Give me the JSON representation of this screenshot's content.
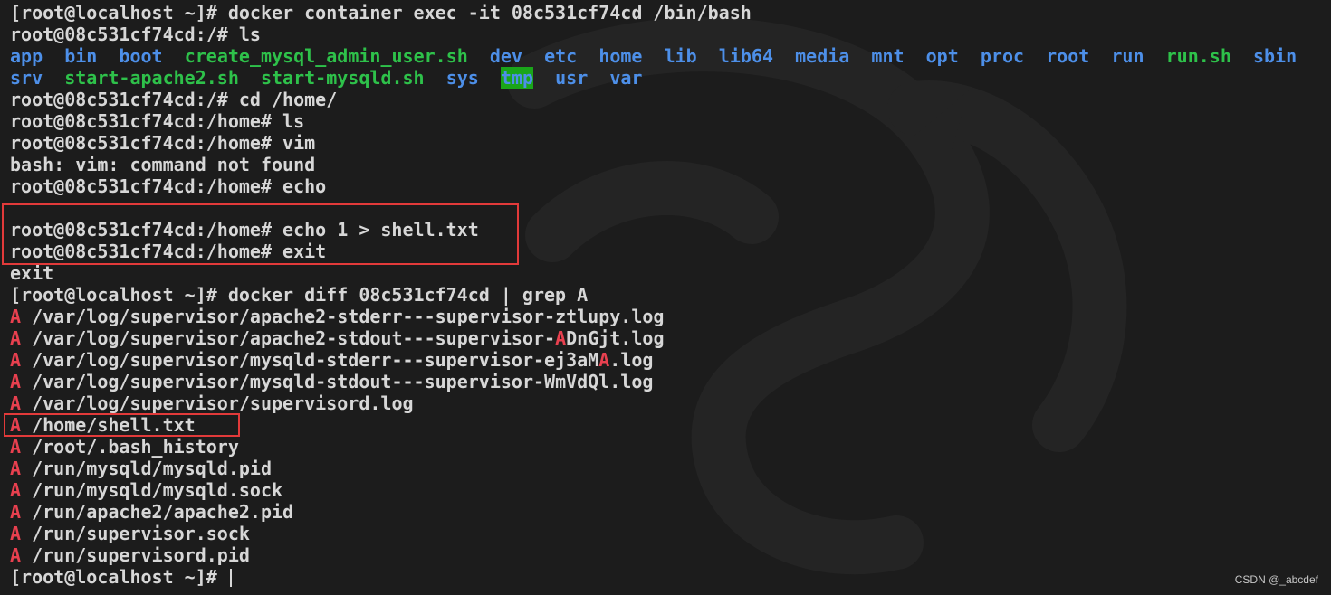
{
  "terminal": {
    "session": [
      {
        "prompt": "[root@localhost ~]# ",
        "command": "docker container exec -it 08c531cf74cd /bin/bash"
      },
      {
        "prompt": "root@08c531cf74cd:/# ",
        "command": "ls"
      }
    ],
    "ls_output": {
      "row1": [
        {
          "name": "app",
          "color": "blue"
        },
        {
          "name": "bin",
          "color": "blue"
        },
        {
          "name": "boot",
          "color": "blue"
        },
        {
          "name": "create_mysql_admin_user.sh",
          "color": "green"
        },
        {
          "name": "dev",
          "color": "blue"
        },
        {
          "name": "etc",
          "color": "blue"
        },
        {
          "name": "home",
          "color": "blue"
        },
        {
          "name": "lib",
          "color": "blue"
        },
        {
          "name": "lib64",
          "color": "blue"
        },
        {
          "name": "media",
          "color": "blue"
        },
        {
          "name": "mnt",
          "color": "blue"
        },
        {
          "name": "opt",
          "color": "blue"
        },
        {
          "name": "proc",
          "color": "blue"
        },
        {
          "name": "root",
          "color": "blue"
        },
        {
          "name": "run",
          "color": "blue"
        },
        {
          "name": "run.sh",
          "color": "green"
        },
        {
          "name": "sbin",
          "color": "blue"
        }
      ],
      "row2": [
        {
          "name": "srv",
          "color": "blue"
        },
        {
          "name": "start-apache2.sh",
          "color": "green"
        },
        {
          "name": "start-mysqld.sh",
          "color": "green"
        },
        {
          "name": "sys",
          "color": "blue"
        },
        {
          "name": "tmp",
          "color": "tmp"
        },
        {
          "name": "usr",
          "color": "blue"
        },
        {
          "name": "var",
          "color": "blue"
        }
      ]
    },
    "lines_after_ls": [
      "root@08c531cf74cd:/# cd /home/",
      "root@08c531cf74cd:/home# ls",
      "root@08c531cf74cd:/home# vim",
      "bash: vim: command not found",
      "root@08c531cf74cd:/home# echo",
      "",
      "root@08c531cf74cd:/home# echo 1 > shell.txt",
      "root@08c531cf74cd:/home# exit",
      "exit",
      "[root@localhost ~]# docker diff 08c531cf74cd | grep A"
    ],
    "diff_marker": "A",
    "diff_output": [
      "/var/log/supervisor/apache2-stderr---supervisor-ztlupy.log",
      "/var/log/supervisor/apache2-stdout---supervisor-ADnGjt.log",
      "/var/log/supervisor/mysqld-stderr---supervisor-ej3aMA.log",
      "/var/log/supervisor/mysqld-stdout---supervisor-WmVdQl.log",
      "/var/log/supervisor/supervisord.log",
      "/home/shell.txt",
      "/root/.bash_history",
      "/run/mysqld/mysqld.pid",
      "/run/mysqld/mysqld.sock",
      "/run/apache2/apache2.pid",
      "/run/supervisor.sock",
      "/run/supervisord.pid"
    ],
    "final_prompt": "[root@localhost ~]# "
  },
  "credit": "CSDN @_abcdef",
  "colors": {
    "background": "#1c1c1c",
    "text": "#d7d7d7",
    "directory": "#4d8fe8",
    "executable": "#2ec14a",
    "grep_match": "#e8404f",
    "tmp_background": "#1aa51a",
    "annotation_box": "#e23a3a"
  }
}
